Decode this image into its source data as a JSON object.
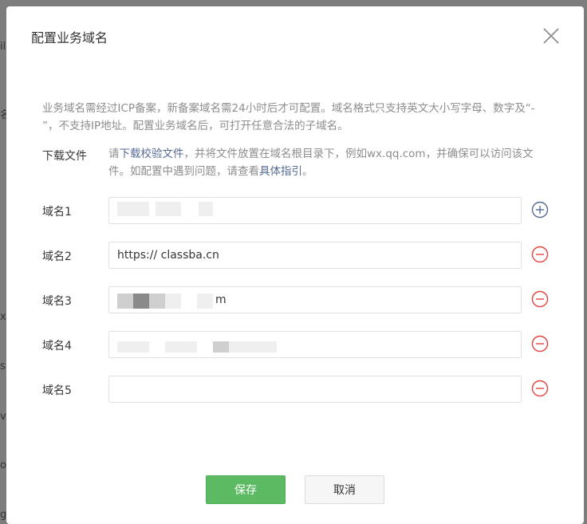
{
  "background": {
    "edge_fragments": [
      "il",
      "名",
      "xu",
      "s",
      "vi",
      "oo",
      "g"
    ]
  },
  "dialog": {
    "title": "配置业务域名",
    "close_icon": "close-icon",
    "description": "业务域名需经过ICP备案，新备案域名需24小时后才可配置。域名格式只支持英文大小写字母、数字及“- ”，不支持IP地址。配置业务域名后，可打开任意合法的子域名。",
    "download": {
      "label": "下载文件",
      "prefix": "请",
      "link1": "下载校验文件",
      "middle": "，并将文件放置在域名根目录下，例如wx.qq.com，并确保可以访问该文件。如配置中遇到问题，请查看",
      "link2": "具体指引",
      "suffix": "。"
    },
    "domains": [
      {
        "label": "域名1",
        "value": "",
        "action": "add",
        "icon": "plus-circle-icon"
      },
      {
        "label": "域名2",
        "value": "https:// classba.cn",
        "action": "remove",
        "icon": "minus-circle-icon"
      },
      {
        "label": "域名3",
        "value": "m",
        "action": "remove",
        "icon": "minus-circle-icon"
      },
      {
        "label": "域名4",
        "value": "",
        "action": "remove",
        "icon": "minus-circle-icon"
      },
      {
        "label": "域名5",
        "value": "",
        "action": "remove",
        "icon": "minus-circle-icon"
      }
    ],
    "buttons": {
      "save": "保存",
      "cancel": "取消"
    }
  },
  "colors": {
    "primary_green": "#5cba63",
    "remove_red": "#e64340",
    "add_blue": "#576b95",
    "link_blue": "#576b95"
  }
}
